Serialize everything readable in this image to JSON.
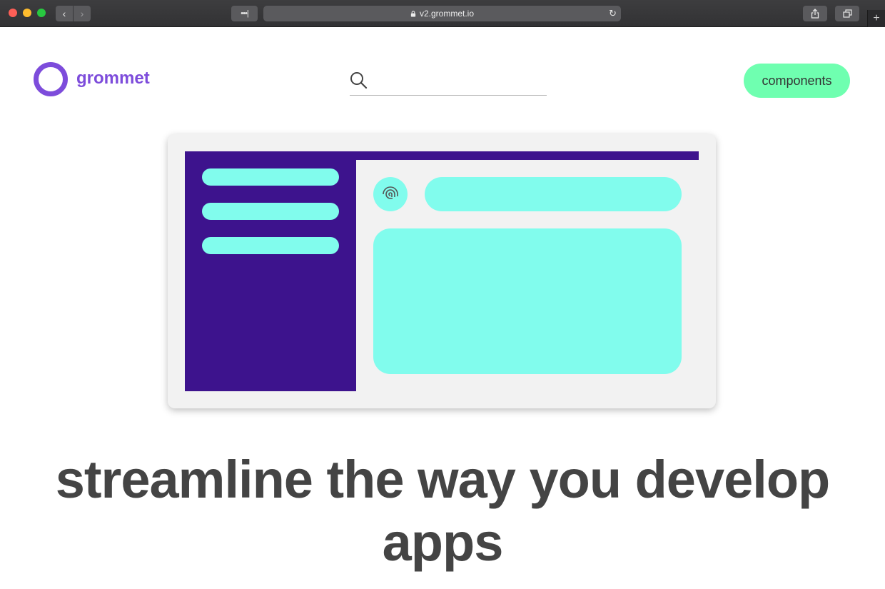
{
  "browser": {
    "url": "v2.grommet.io",
    "reader_glyph": "•••|",
    "back_glyph": "‹",
    "forward_glyph": "›",
    "reload_glyph": "↻",
    "new_tab_glyph": "+"
  },
  "header": {
    "brand": "grommet",
    "search_placeholder": "",
    "components_label": "components"
  },
  "hero": {
    "headline": "streamline the way you develop apps"
  },
  "colors": {
    "brand": "#7d4cdb",
    "accent": "#6fffb0",
    "illustration_dark": "#3d138d",
    "illustration_light": "#81fced",
    "headline": "#444444"
  },
  "icons": {
    "search": "search-icon",
    "avatar": "fingerprint-icon",
    "logo": "grommet-ring-icon"
  }
}
